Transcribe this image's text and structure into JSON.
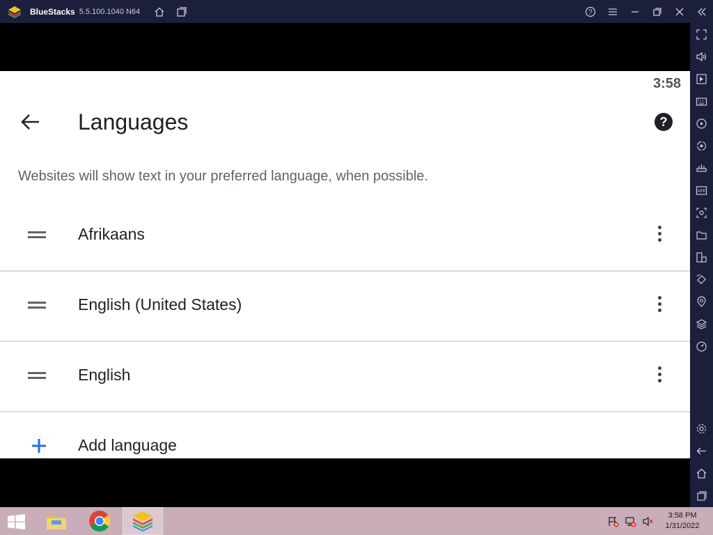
{
  "titlebar": {
    "app_name": "BlueStacks",
    "version": "5.5.100.1040 N64",
    "icons": [
      "bluestacks-logo",
      "home-icon",
      "multi-instance-icon",
      "help-icon",
      "menu-icon",
      "minimize-icon",
      "restore-icon",
      "close-icon",
      "collapse-sidebar-icon"
    ]
  },
  "sidebar": {
    "icons": [
      "fullscreen-icon",
      "volume-icon",
      "media-manager-icon",
      "keyboard-icon",
      "macro-icon",
      "sync-icon",
      "controls-icon",
      "install-apk-icon",
      "screenshot-icon",
      "folder-icon",
      "multi-instance-manager-icon",
      "rotate-icon",
      "location-icon",
      "layers-icon",
      "performance-icon",
      "settings-icon",
      "back-icon",
      "home-icon",
      "recent-apps-icon"
    ]
  },
  "android": {
    "status_time": "3:58",
    "page_title": "Languages",
    "description": "Websites will show text in your preferred language, when possible.",
    "languages": [
      {
        "name": "Afrikaans"
      },
      {
        "name": "English (United States)"
      },
      {
        "name": "English"
      }
    ],
    "add_language_label": "Add language"
  },
  "taskbar": {
    "apps": [
      "windows-start-icon",
      "file-explorer-icon",
      "chrome-icon",
      "bluestacks-icon"
    ],
    "active_app": "bluestacks-icon",
    "tray_icons": [
      "action-center-flag-icon",
      "network-icon",
      "volume-muted-icon"
    ],
    "clock_time": "3:58 PM",
    "clock_date": "1/31/2022"
  },
  "colors": {
    "titlebar_bg": "#1b1f3b",
    "taskbar_bg": "#c9adb9",
    "accent_blue": "#1a73e8",
    "text_primary": "#202124",
    "text_secondary": "#5f6368"
  }
}
